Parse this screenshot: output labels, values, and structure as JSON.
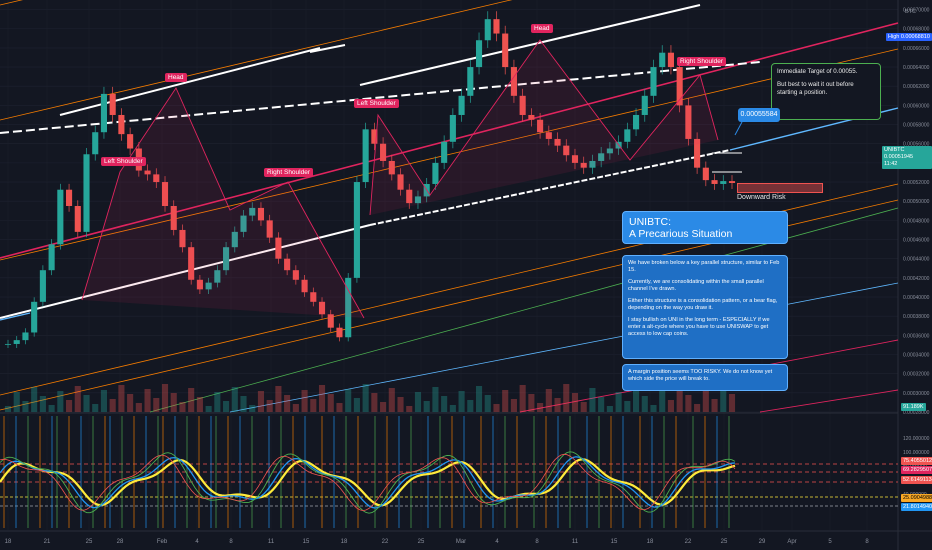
{
  "chart_data": {
    "type": "candlestick",
    "symbol": "UNIBTC",
    "quote_currency": "BTC",
    "price_axis_labels": [
      "0.00070000",
      "0.00068000",
      "0.00066000",
      "0.00064000",
      "0.00062000",
      "0.00060000",
      "0.00058000",
      "0.00056000",
      "0.00054000",
      "0.00052000",
      "0.00050000",
      "0.00048000",
      "0.00046000",
      "0.00044000",
      "0.00042000",
      "0.00040000",
      "0.00038000",
      "0.00036000",
      "0.00034000",
      "0.00032000",
      "0.00030000",
      "0.00028000"
    ],
    "date_axis_labels": [
      "18",
      "21",
      "25",
      "28",
      "Feb",
      "4",
      "8",
      "11",
      "15",
      "18",
      "22",
      "25",
      "Mar",
      "4",
      "8",
      "11",
      "15",
      "18",
      "22",
      "25",
      "29",
      "Apr",
      "5",
      "8"
    ],
    "oscillator_axis_labels": [
      "120.000000",
      "100.000000",
      "80.000000",
      "60.000000",
      "40.000000",
      "20.000000"
    ],
    "axis_tags": {
      "high": "High",
      "high_value": "0.00068810",
      "last_symbol": "UNIBTC",
      "last_value": "0.00051945",
      "last_countdown": "11:42",
      "volume": "91.189K",
      "osc_red": "75.40550120",
      "osc_purple": "69.28295076",
      "osc_gray": "52.61491134",
      "osc_yellow": "25.0904988",
      "osc_blue": "21.80149404"
    },
    "series": [
      {
        "name": "UNIBTC",
        "ohlc_close": [
          0.000351,
          0.000355,
          0.000363,
          0.000395,
          0.000428,
          0.000455,
          0.000512,
          0.000495,
          0.000468,
          0.000549,
          0.000572,
          0.000612,
          0.00059,
          0.00057,
          0.000555,
          0.000532,
          0.000528,
          0.00052,
          0.000495,
          0.00047,
          0.000452,
          0.000418,
          0.000408,
          0.000415,
          0.000428,
          0.000452,
          0.000468,
          0.000485,
          0.000493,
          0.00048,
          0.000462,
          0.00044,
          0.000428,
          0.000418,
          0.000405,
          0.000395,
          0.000382,
          0.000368,
          0.000358,
          0.00042,
          0.00052,
          0.000575,
          0.00056,
          0.000542,
          0.000528,
          0.000512,
          0.000498,
          0.000505,
          0.000518,
          0.00054,
          0.000562,
          0.00059,
          0.00061,
          0.00064,
          0.000668,
          0.00069,
          0.000675,
          0.00064,
          0.00061,
          0.00059,
          0.000585,
          0.000572,
          0.000565,
          0.000558,
          0.000548,
          0.00054,
          0.000535,
          0.000542,
          0.00055,
          0.000555,
          0.000562,
          0.000575,
          0.00059,
          0.00061,
          0.00064,
          0.000655,
          0.00064,
          0.0006,
          0.000565,
          0.000535,
          0.000522,
          0.000518,
          0.000521,
          0.000519
        ]
      }
    ],
    "annotations": {
      "patterns": [
        {
          "text": "Left Shoulder"
        },
        {
          "text": "Head"
        },
        {
          "text": "Right Shoulder"
        },
        {
          "text": "Left Shoulder"
        },
        {
          "text": "Head"
        },
        {
          "text": "Right Shoulder"
        }
      ],
      "price_callout": "0.00055584",
      "downward_risk": "Downward Risk",
      "target_note": [
        "Immediate Target of 0.00055.",
        "But best to wait it out before starting a position."
      ],
      "title": [
        "UNIBTC:",
        "A Precarious Situation"
      ],
      "body": [
        "We have broken below a key parallel structure, similar to Feb 15.",
        "Currently, we are consolidating within the small parallel channel I've drawn.",
        "Either this structure is a consolidation pattern, or a bear flag, depending on the way you draw it.",
        "I stay bullish on UNI in the long term - ESPECIALLY if we enter a alt-cycle where you have to use UNISWAP to get access to low cap coins."
      ],
      "margin_note": "A margin position seems TOO RISKY. We do not know yet which side the price will break to."
    },
    "colors": {
      "background": "#131722",
      "up": "#26a69a",
      "down": "#ef5350",
      "pattern": "#e0245e",
      "channel_white": "#ffffff",
      "channel_pink": "#e0245e",
      "channel_orange": "#f57c00",
      "channel_blue": "#5fb8ff",
      "channel_green": "#4caf50",
      "osc_yellow": "#ffeb3b",
      "osc_blue": "#2196f3",
      "osc_green": "#4caf50",
      "osc_red": "#ef5350"
    }
  }
}
